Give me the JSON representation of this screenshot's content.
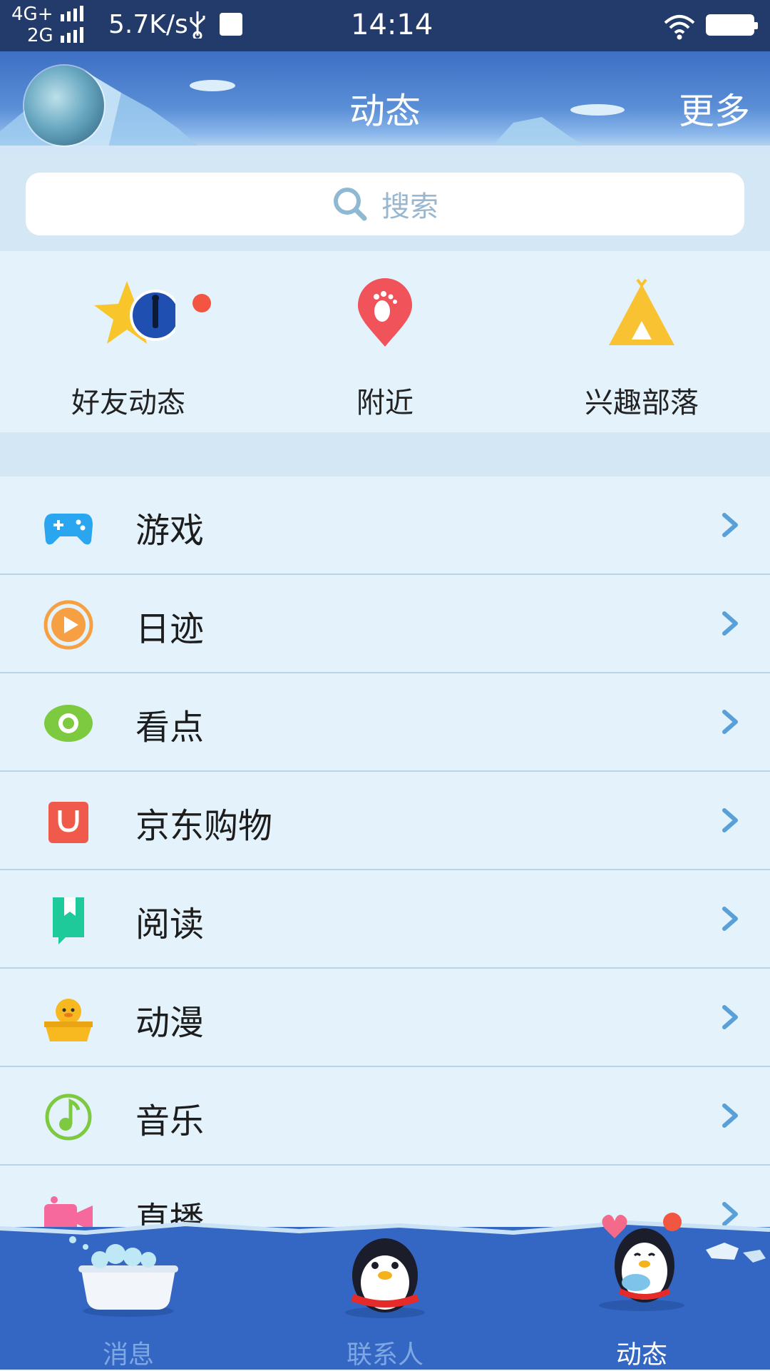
{
  "status_bar": {
    "network_line1": "4G+",
    "network_line2": "2G",
    "speed": "5.7K/s",
    "time": "14:14"
  },
  "header": {
    "title": "动态",
    "more_label": "更多"
  },
  "search": {
    "placeholder": "搜索"
  },
  "quick_entries": [
    {
      "label": "好友动态",
      "icon": "friends-star-icon",
      "badge": true
    },
    {
      "label": "附近",
      "icon": "footprint-pin-icon"
    },
    {
      "label": "兴趣部落",
      "icon": "tent-icon"
    }
  ],
  "list_items": [
    {
      "label": "游戏",
      "icon": "gamepad-icon",
      "color": "#2aa6f0"
    },
    {
      "label": "日迹",
      "icon": "play-circle-icon",
      "color": "#f6a043"
    },
    {
      "label": "看点",
      "icon": "eye-icon",
      "color": "#7dc940"
    },
    {
      "label": "京东购物",
      "icon": "shopping-bag-icon",
      "color": "#ef5a4b"
    },
    {
      "label": "阅读",
      "icon": "bookmark-icon",
      "color": "#1ec99a"
    },
    {
      "label": "动漫",
      "icon": "duck-icon",
      "color": "#f8b820"
    },
    {
      "label": "音乐",
      "icon": "music-note-icon",
      "color": "#7dc940"
    },
    {
      "label": "直播",
      "icon": "video-camera-icon",
      "color": "#f5699d"
    }
  ],
  "bottom_nav": [
    {
      "label": "消息",
      "icon": "bathtub-icon",
      "active": false
    },
    {
      "label": "联系人",
      "icon": "penguin-icon",
      "active": false
    },
    {
      "label": "动态",
      "icon": "penguin-heart-icon",
      "active": true
    }
  ],
  "colors": {
    "status_bar": "#233b6a",
    "header": "#4a7fd0",
    "background": "#e3f2fb",
    "chevron": "#5aa0d8",
    "badge": "#f25640",
    "nav_bg": "#3467c4"
  }
}
